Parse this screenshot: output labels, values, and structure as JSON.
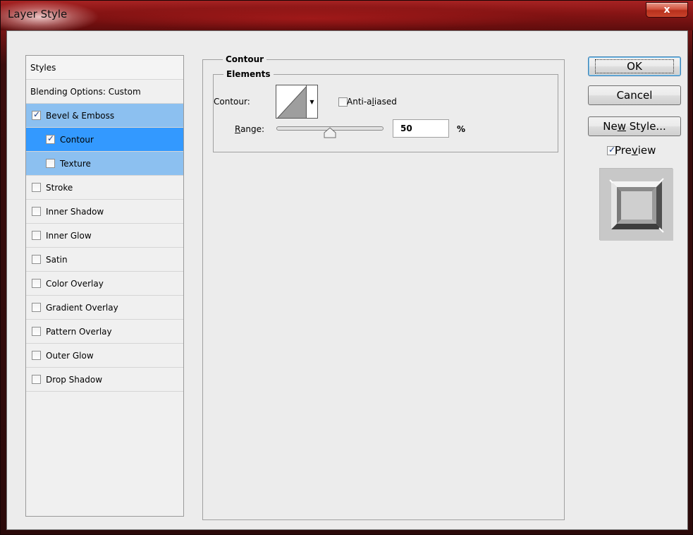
{
  "window": {
    "title": "Layer Style",
    "close_glyph": "x"
  },
  "styles_panel": {
    "header": "Styles",
    "blending": "Blending Options: Custom",
    "items": [
      {
        "label": "Bevel & Emboss",
        "checked": true,
        "sub": false,
        "state": "selected"
      },
      {
        "label": "Contour",
        "checked": true,
        "sub": true,
        "state": "active"
      },
      {
        "label": "Texture",
        "checked": false,
        "sub": true,
        "state": "selected"
      },
      {
        "label": "Stroke",
        "checked": false,
        "sub": false,
        "state": "none"
      },
      {
        "label": "Inner Shadow",
        "checked": false,
        "sub": false,
        "state": "none"
      },
      {
        "label": "Inner Glow",
        "checked": false,
        "sub": false,
        "state": "none"
      },
      {
        "label": "Satin",
        "checked": false,
        "sub": false,
        "state": "none"
      },
      {
        "label": "Color Overlay",
        "checked": false,
        "sub": false,
        "state": "none"
      },
      {
        "label": "Gradient Overlay",
        "checked": false,
        "sub": false,
        "state": "none"
      },
      {
        "label": "Pattern Overlay",
        "checked": false,
        "sub": false,
        "state": "none"
      },
      {
        "label": "Outer Glow",
        "checked": false,
        "sub": false,
        "state": "none"
      },
      {
        "label": "Drop Shadow",
        "checked": false,
        "sub": false,
        "state": "none"
      }
    ]
  },
  "contour_panel": {
    "group_title": "Contour",
    "subgroup_title": "Elements",
    "contour_label": "Contour:",
    "anti_aliased": {
      "pre": "Anti-a",
      "mnemonic": "l",
      "post": "iased",
      "checked": false
    },
    "range": {
      "mnemonic": "R",
      "rest": "ange:",
      "value": "50",
      "unit": "%",
      "slider_fraction": 0.5
    }
  },
  "buttons": {
    "ok": "OK",
    "cancel": "Cancel",
    "new_style": {
      "pre": "Ne",
      "mnemonic": "w",
      "post": " Style..."
    },
    "preview": {
      "pre": "Pre",
      "mnemonic": "v",
      "post": "iew",
      "checked": true
    }
  },
  "colors": {
    "selected_row": "#8cc0f0",
    "active_row": "#3399ff",
    "client_bg": "#ececec"
  }
}
